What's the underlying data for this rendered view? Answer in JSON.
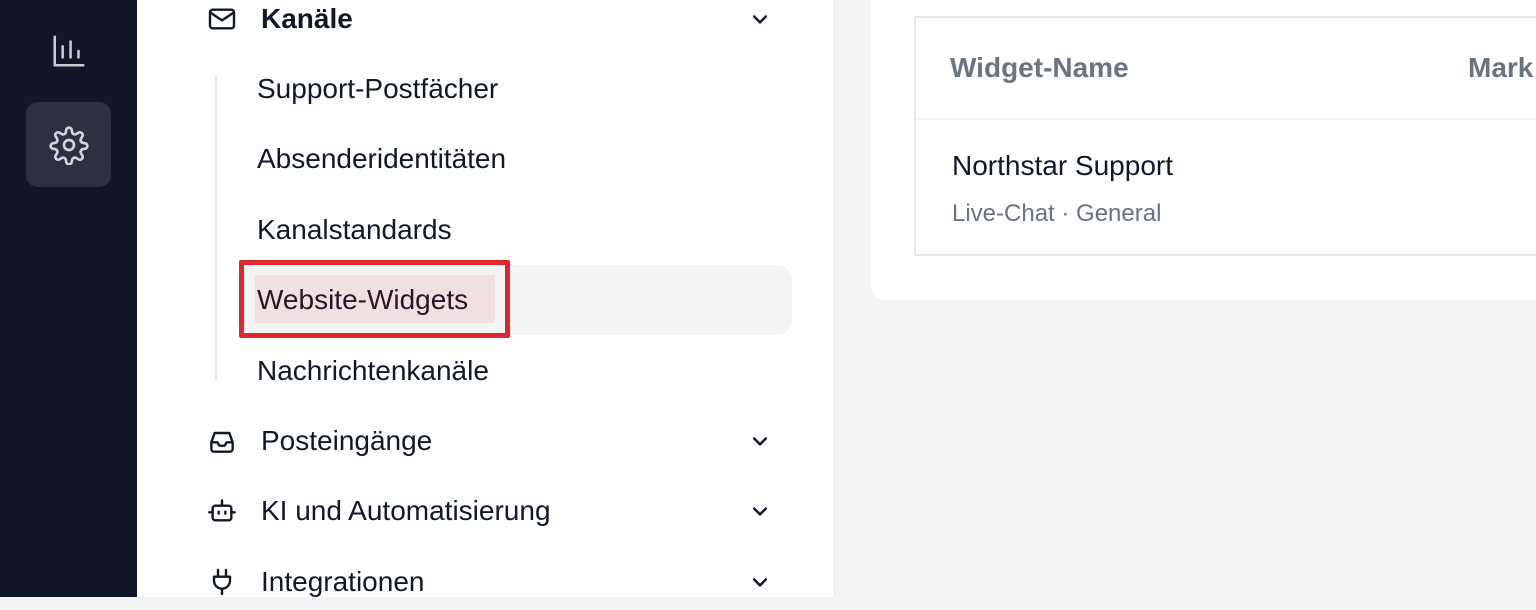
{
  "rail": {
    "items": [
      {
        "icon": "bar-chart-icon",
        "active": false
      },
      {
        "icon": "gear-icon",
        "active": true
      }
    ]
  },
  "sidebar": {
    "channels": {
      "label": "Kanäle",
      "expanded": true,
      "items": [
        {
          "label": "Support-Postfächer",
          "selected": false
        },
        {
          "label": "Absenderidentitäten",
          "selected": false
        },
        {
          "label": "Kanalstandards",
          "selected": false
        },
        {
          "label": "Website-Widgets",
          "selected": true
        },
        {
          "label": "Nachrichtenkanäle",
          "selected": false
        }
      ]
    },
    "groups": [
      {
        "label": "Posteingänge",
        "icon": "inbox-icon"
      },
      {
        "label": "KI und Automatisierung",
        "icon": "bot-icon"
      },
      {
        "label": "Integrationen",
        "icon": "plug-icon"
      }
    ]
  },
  "main": {
    "table": {
      "columns": [
        "Widget-Name",
        "Mark"
      ],
      "rows": [
        {
          "name": "Northstar Support",
          "meta": "Live-Chat · General"
        }
      ]
    }
  },
  "colors": {
    "rail_bg": "#111729",
    "rail_active": "#2a3140",
    "highlight": "#e1262c",
    "selected_bg": "#f3f4f6"
  }
}
